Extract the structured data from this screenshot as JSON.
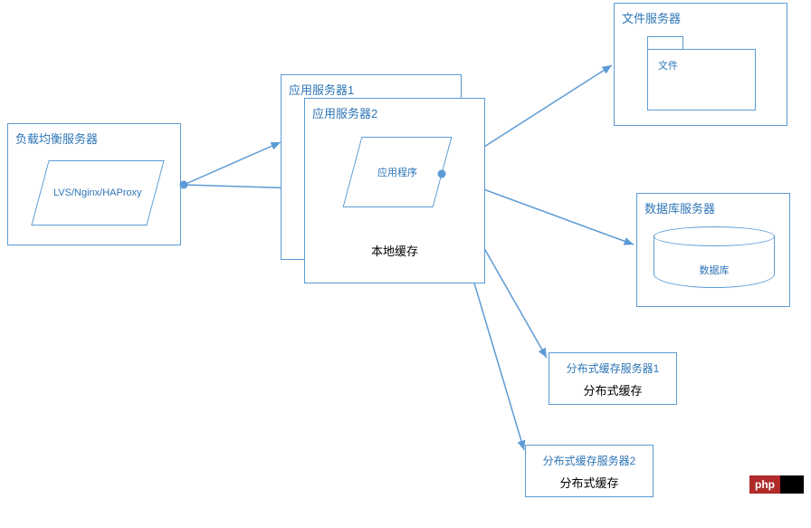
{
  "loadBalancer": {
    "title": "负载均衡服务器",
    "tech": "LVS/Nginx/HAProxy"
  },
  "appServer1": {
    "title": "应用服务器1"
  },
  "appServer2": {
    "title": "应用服务器2",
    "app": "应用程序",
    "cache": "本地缓存"
  },
  "fileServer": {
    "title": "文件服务器",
    "folder": "文件"
  },
  "dbServer": {
    "title": "数据库服务器",
    "db": "数据库"
  },
  "distCache1": {
    "title": "分布式缓存服务器1",
    "label": "分布式缓存"
  },
  "distCache2": {
    "title": "分布式缓存服务器2",
    "label": "分布式缓存"
  },
  "badge": {
    "left": "php",
    "right": ""
  }
}
